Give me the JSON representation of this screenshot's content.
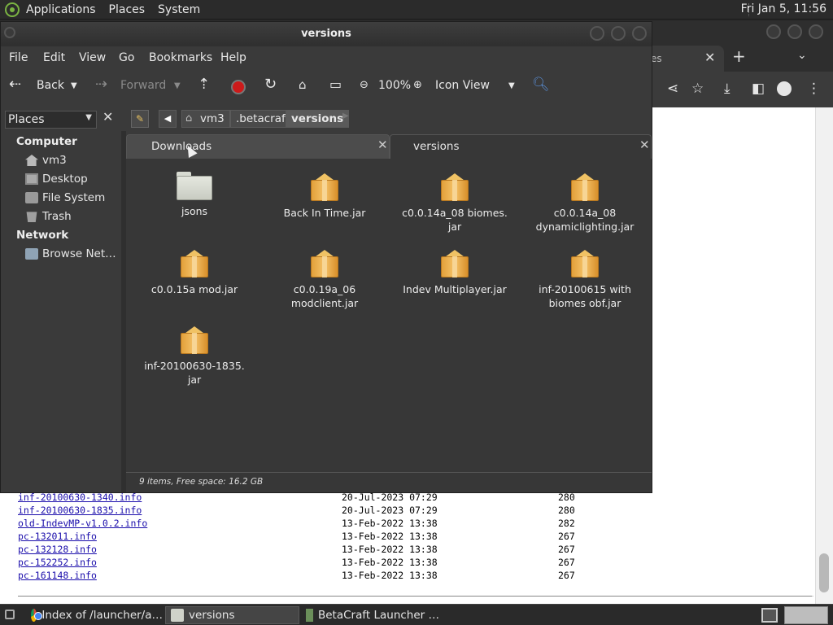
{
  "top_panel": {
    "menus": [
      "Applications",
      "Places",
      "System"
    ],
    "clock": "Fri Jan  5, 11:56"
  },
  "browser": {
    "tab_partial_title": "es",
    "close_glyph": "✕",
    "new_tab_glyph": "+",
    "tab_list_glyph": "⌄",
    "toolbar_icons": [
      "share-icon",
      "star-icon",
      "download-icon",
      "sidebar-icon",
      "profile-icon",
      "kebab-menu-icon"
    ]
  },
  "listing": {
    "rows": [
      {
        "name": "inf-20100630-1340.info",
        "date": "20-Jul-2023 07:29",
        "size": "280"
      },
      {
        "name": "inf-20100630-1835.info",
        "date": "20-Jul-2023 07:29",
        "size": "280"
      },
      {
        "name": "old-IndevMP-v1.0.2.info",
        "date": "13-Feb-2022 13:38",
        "size": "282"
      },
      {
        "name": "pc-132011.info",
        "date": "13-Feb-2022 13:38",
        "size": "267"
      },
      {
        "name": "pc-132128.info",
        "date": "13-Feb-2022 13:38",
        "size": "267"
      },
      {
        "name": "pc-152252.info",
        "date": "13-Feb-2022 13:38",
        "size": "267"
      },
      {
        "name": "pc-161148.info",
        "date": "13-Feb-2022 13:38",
        "size": "267"
      }
    ]
  },
  "file_manager": {
    "title": "versions",
    "menus": [
      "File",
      "Edit",
      "View",
      "Go",
      "Bookmarks",
      "Help"
    ],
    "toolbar": {
      "back": "Back",
      "forward": "Forward",
      "zoom": "100%",
      "view_mode": "Icon View"
    },
    "sidebar": {
      "combo": "Places",
      "sections": [
        {
          "header": "Computer",
          "items": [
            "vm3",
            "Desktop",
            "File System",
            "Trash"
          ]
        },
        {
          "header": "Network",
          "items": [
            "Browse Net…"
          ]
        }
      ]
    },
    "breadcrumbs": [
      "vm3",
      ".betacraft",
      "versions"
    ],
    "tabs": [
      {
        "title": "Downloads"
      },
      {
        "title": "versions"
      }
    ],
    "items": [
      {
        "name": "jsons",
        "kind": "folder"
      },
      {
        "name": "Back In Time.jar",
        "kind": "jar"
      },
      {
        "name": "c0.0.14a_08 biomes.\njar",
        "kind": "jar"
      },
      {
        "name": "c0.0.14a_08\ndynamiclighting.jar",
        "kind": "jar"
      },
      {
        "name": "c0.0.15a mod.jar",
        "kind": "jar"
      },
      {
        "name": "c0.0.19a_06\nmodclient.jar",
        "kind": "jar"
      },
      {
        "name": "Indev Multiplayer.jar",
        "kind": "jar"
      },
      {
        "name": "inf-20100615 with\nbiomes obf.jar",
        "kind": "jar"
      },
      {
        "name": "inf-20100630-1835.\njar",
        "kind": "jar"
      }
    ],
    "status": "9 items, Free space: 16.2 GB"
  },
  "taskbar": {
    "tasks": [
      {
        "label": "Index of /launcher/a…",
        "icon": "chrome-icon"
      },
      {
        "label": "versions",
        "icon": "folder-icon"
      },
      {
        "label": "BetaCraft Launcher …",
        "icon": "betacraft-icon"
      }
    ]
  }
}
